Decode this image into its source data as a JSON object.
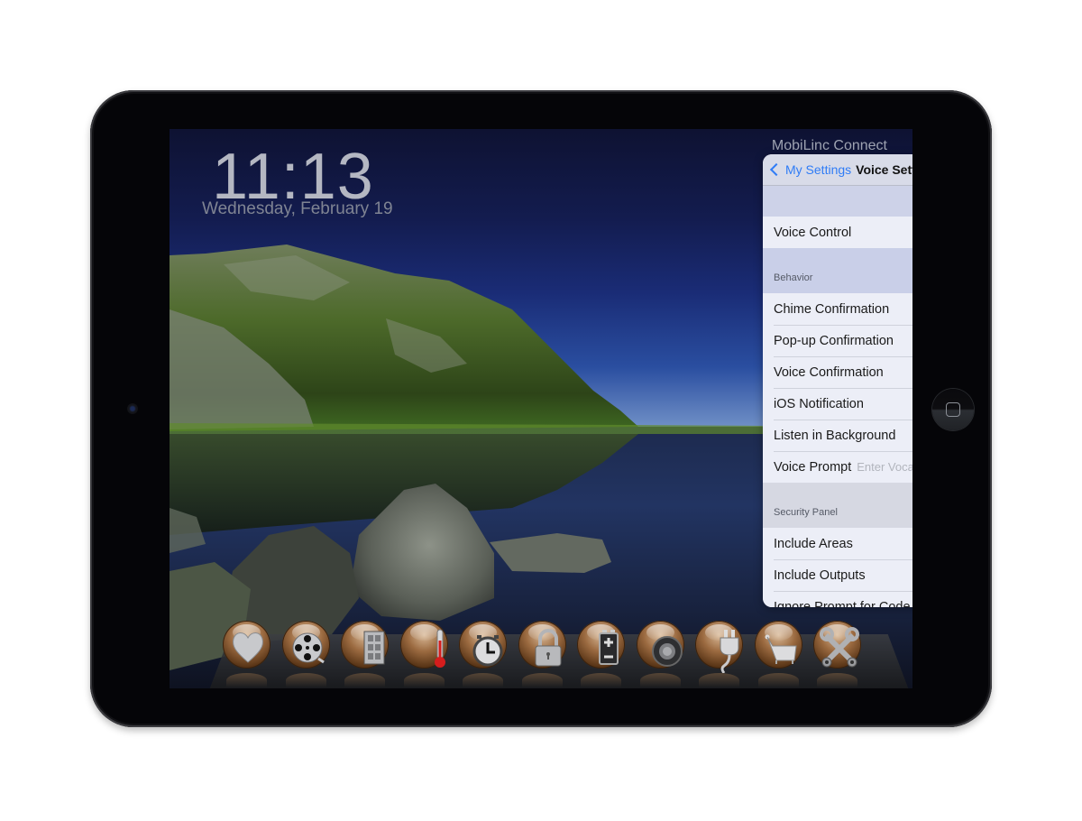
{
  "lock_screen": {
    "time": "11:13",
    "date": "Wednesday, February 19",
    "app_title": "MobiLinc Connect"
  },
  "popover": {
    "back_label": "My Settings",
    "title": "Voice Settings",
    "voice_control": {
      "label": "Voice Control",
      "on": true
    },
    "behavior": {
      "header": "Behavior",
      "rows": [
        {
          "label": "Chime Confirmation",
          "on": true
        },
        {
          "label": "Pop-up Confirmation",
          "on": true
        },
        {
          "label": "Voice Confirmation",
          "on": true
        },
        {
          "label": "iOS Notification",
          "on": true
        },
        {
          "label": "Listen in Background",
          "on": true
        }
      ],
      "voice_prompt": {
        "label": "Voice Prompt",
        "value": "",
        "placeholder": "Enter Vocal Prompt"
      }
    },
    "security_panel": {
      "header": "Security Panel",
      "rows": [
        {
          "label": "Include Areas",
          "on": true
        },
        {
          "label": "Include Outputs",
          "on": true
        },
        {
          "label": "Ignore Prompt for Code",
          "on": false
        }
      ]
    }
  },
  "dock": {
    "items": [
      {
        "name": "favorites",
        "icon": "heart-icon"
      },
      {
        "name": "scenes",
        "icon": "film-reel-icon"
      },
      {
        "name": "devices",
        "icon": "door-panel-icon"
      },
      {
        "name": "thermostats",
        "icon": "thermometer-icon"
      },
      {
        "name": "schedules",
        "icon": "timer-clock-icon"
      },
      {
        "name": "security",
        "icon": "padlock-icon"
      },
      {
        "name": "energy",
        "icon": "battery-icon"
      },
      {
        "name": "sensors",
        "icon": "speaker-ring-icon"
      },
      {
        "name": "power",
        "icon": "plug-icon"
      },
      {
        "name": "shopping",
        "icon": "shopping-cart-icon"
      },
      {
        "name": "settings",
        "icon": "wrench-screwdriver-icon"
      }
    ]
  },
  "colors": {
    "toggle_on": "#4cd964",
    "link_blue": "#2f7cf6"
  }
}
